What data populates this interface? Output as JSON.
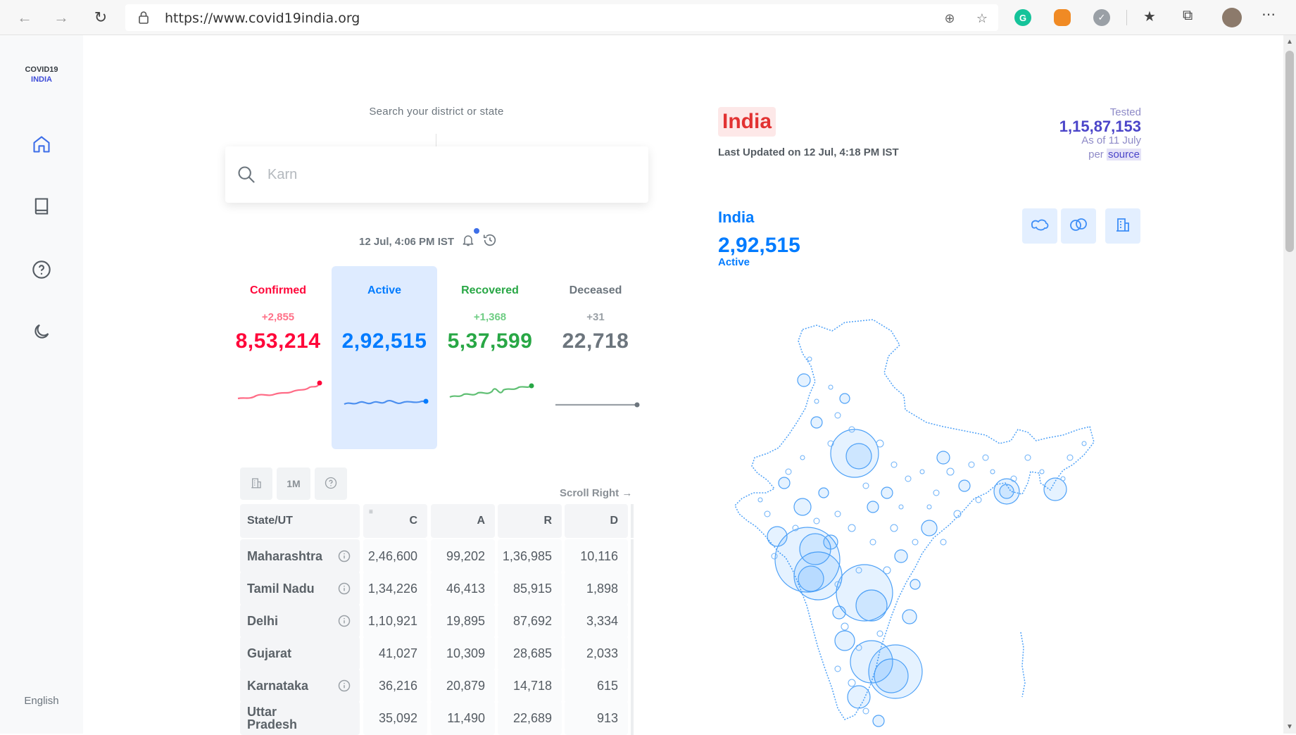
{
  "browser": {
    "url": "https://www.covid19india.org"
  },
  "sidebar": {
    "logo_line1": "COVID19",
    "logo_line2": "INDIA",
    "language": "English"
  },
  "search": {
    "label": "Search your district or state",
    "placeholder": "Karn"
  },
  "update": {
    "timestamp": "12 Jul, 4:06 PM IST"
  },
  "levels": [
    {
      "label": "Confirmed",
      "delta": "+2,855",
      "total": "8,53,214"
    },
    {
      "label": "Active",
      "delta": "",
      "total": "2,92,515"
    },
    {
      "label": "Recovered",
      "delta": "+1,368",
      "total": "5,37,599"
    },
    {
      "label": "Deceased",
      "delta": "+31",
      "total": "22,718"
    }
  ],
  "table_controls": {
    "period": "1M",
    "scroll_hint": "Scroll Right →"
  },
  "table": {
    "headers": [
      "State/UT",
      "C",
      "A",
      "R",
      "D"
    ],
    "rows": [
      {
        "state": "Maharashtra",
        "c": "2,46,600",
        "a": "99,202",
        "r": "1,36,985",
        "d": "10,116",
        "info": true
      },
      {
        "state": "Tamil Nadu",
        "c": "1,34,226",
        "a": "46,413",
        "r": "85,915",
        "d": "1,898",
        "info": true
      },
      {
        "state": "Delhi",
        "c": "1,10,921",
        "a": "19,895",
        "r": "87,692",
        "d": "3,334",
        "info": true
      },
      {
        "state": "Gujarat",
        "c": "41,027",
        "a": "10,309",
        "r": "28,685",
        "d": "2,033",
        "info": false
      },
      {
        "state": "Karnataka",
        "c": "36,216",
        "a": "20,879",
        "r": "14,718",
        "d": "615",
        "info": true
      },
      {
        "state": "Uttar Pradesh",
        "c": "35,092",
        "a": "11,490",
        "r": "22,689",
        "d": "913",
        "info": false
      }
    ]
  },
  "map": {
    "title": "India",
    "last_updated": "Last Updated on 12 Jul, 4:18 PM IST",
    "tested_label": "Tested",
    "tested_value": "1,15,87,153",
    "tested_date": "As of 11 July",
    "tested_per": "per",
    "tested_source": "source",
    "region": "India",
    "count": "2,92,515",
    "statistic": "Active"
  },
  "colors": {
    "confirmed": "#ff073a",
    "active": "#007bff",
    "recovered": "#28a745",
    "deceased": "#6c757d",
    "active_card_bg": "#deebff"
  }
}
